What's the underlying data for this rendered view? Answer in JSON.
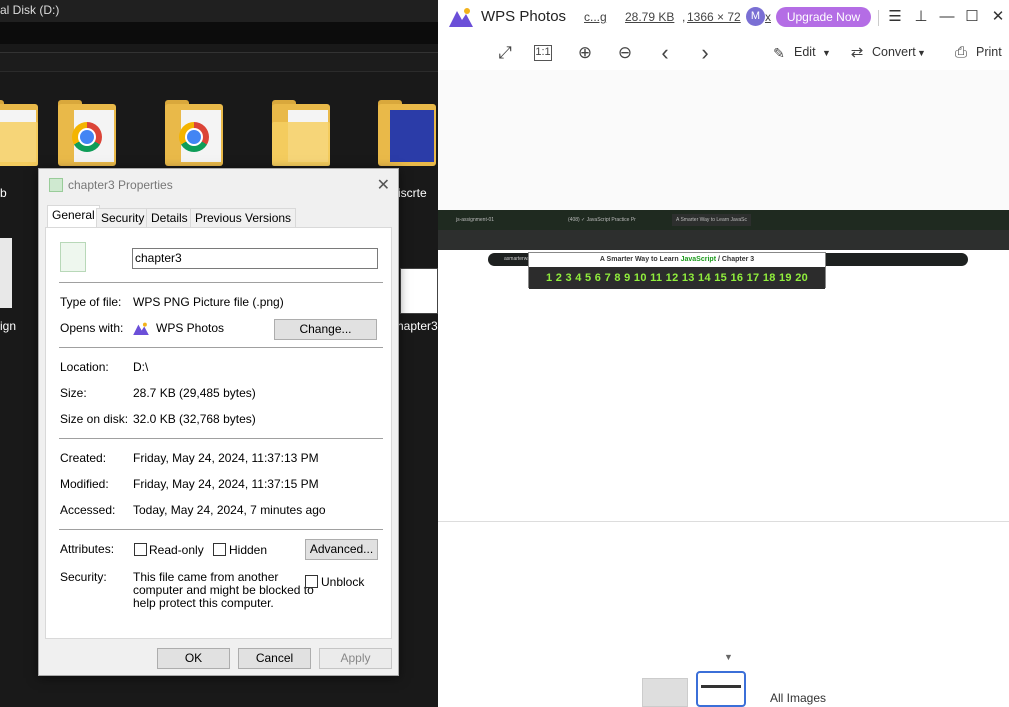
{
  "explorer": {
    "title": "al Disk  (D:)",
    "labels": [
      "b",
      "iscrte",
      "ign",
      "hapter3"
    ]
  },
  "dialog": {
    "title": "chapter3 Properties",
    "tabs": [
      "General",
      "Security",
      "Details",
      "Previous Versions"
    ],
    "filename": "chapter3",
    "type_label": "Type of file:",
    "type_value": "WPS PNG Picture file (.png)",
    "opens_label": "Opens with:",
    "opens_value": "WPS Photos",
    "change_button": "Change...",
    "location_label": "Location:",
    "location_value": "D:\\",
    "size_label": "Size:",
    "size_value": "28.7 KB (29,485 bytes)",
    "sod_label": "Size on disk:",
    "sod_value": "32.0 KB (32,768 bytes)",
    "created_label": "Created:",
    "created_value": "Friday, May 24, 2024, 11:37:13 PM",
    "modified_label": "Modified:",
    "modified_value": "Friday, May 24, 2024, 11:37:15 PM",
    "accessed_label": "Accessed:",
    "accessed_value": "Today, May 24, 2024, 7 minutes ago",
    "attributes_label": "Attributes:",
    "readonly_label": "Read-only",
    "hidden_label": "Hidden",
    "advanced_button": "Advanced...",
    "security_label": "Security:",
    "security_text_1": "This file came from another",
    "security_text_2": "computer and might be blocked to",
    "security_text_3": "help protect this computer.",
    "unblock_label": "Unblock",
    "ok_button": "OK",
    "cancel_button": "Cancel",
    "apply_button": "Apply"
  },
  "wps": {
    "app_title": "WPS Photos",
    "file_name_short": "c...g",
    "file_size": "28.79 KB",
    "dimensions": "1366 × 72",
    "dimensions_tail": "x",
    "avatar_letter": "M",
    "upgrade_button": "Upgrade Now",
    "edit_label": "Edit",
    "convert_label": "Convert",
    "print_label": "Print",
    "all_images_label": "All Images",
    "accent_color": "#b46de5"
  },
  "screenshot": {
    "tabs": [
      "js-assignment-01",
      "(408) ✓ JavaScript Practice Pr",
      "A Smarter Way to Learn JavaSc"
    ],
    "url": "asmarterwaytolearn.com/js/3.html",
    "heading_prefix": "A Smarter Way to Learn",
    "heading_green": "JavaScript",
    "heading_suffix": "/  Chapter 3",
    "numbers": "1 2 3 4 5 6 7 8 9 10 11 12 13 14 15 16 17 18 19 20"
  }
}
